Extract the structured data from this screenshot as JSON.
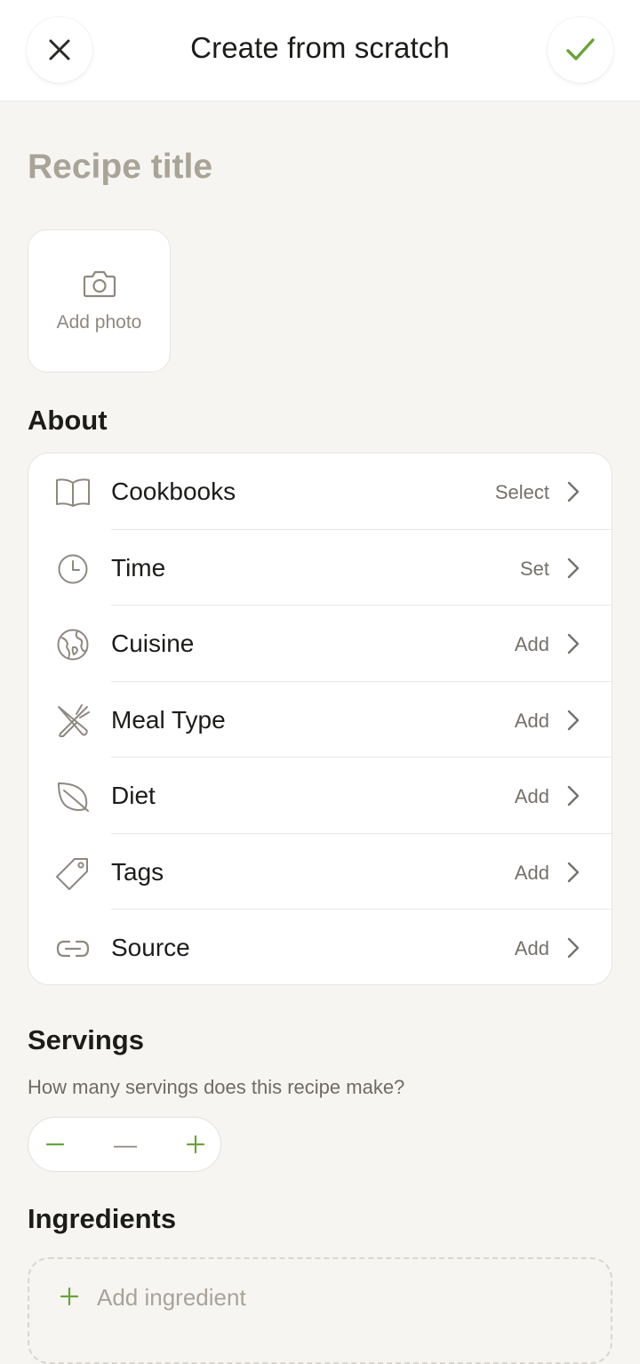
{
  "header": {
    "title": "Create from scratch",
    "close_icon": "close-icon",
    "confirm_icon": "check-icon"
  },
  "recipe": {
    "title_placeholder": "Recipe title",
    "add_photo_label": "Add photo"
  },
  "about": {
    "title": "About",
    "items": [
      {
        "label": "Cookbooks",
        "value": "Select",
        "icon": "book-icon"
      },
      {
        "label": "Time",
        "value": "Set",
        "icon": "clock-icon"
      },
      {
        "label": "Cuisine",
        "value": "Add",
        "icon": "globe-icon"
      },
      {
        "label": "Meal Type",
        "value": "Add",
        "icon": "utensils-icon"
      },
      {
        "label": "Diet",
        "value": "Add",
        "icon": "leaf-icon"
      },
      {
        "label": "Tags",
        "value": "Add",
        "icon": "tag-icon"
      },
      {
        "label": "Source",
        "value": "Add",
        "icon": "link-icon"
      }
    ]
  },
  "servings": {
    "title": "Servings",
    "subtitle": "How many servings does this recipe make?",
    "value": "—"
  },
  "ingredients": {
    "title": "Ingredients",
    "add_label": "Add ingredient"
  },
  "colors": {
    "accent": "#6aa33a",
    "background": "#f6f5f2",
    "placeholder": "#a9a398",
    "icon_gray": "#8e897f"
  }
}
